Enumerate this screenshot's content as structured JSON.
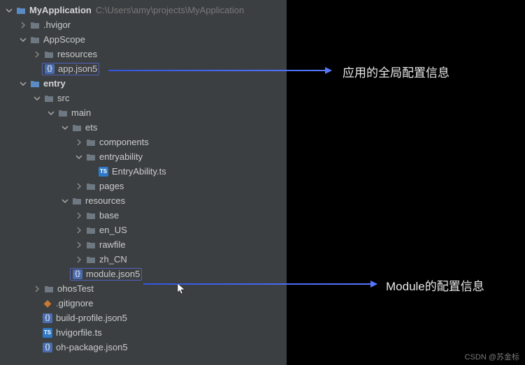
{
  "root": {
    "name": "MyApplication",
    "path": "C:\\Users\\amy\\projects\\MyApplication"
  },
  "tree": {
    "hvigor": ".hvigor",
    "appscope": "AppScope",
    "appscope_resources": "resources",
    "app_json5": "app.json5",
    "entry": "entry",
    "src": "src",
    "main": "main",
    "ets": "ets",
    "components": "components",
    "entryability": "entryability",
    "entryability_ts": "EntryAbility.ts",
    "pages": "pages",
    "resources": "resources",
    "base": "base",
    "en_us": "en_US",
    "rawfile": "rawfile",
    "zh_cn": "zh_CN",
    "module_json5": "module.json5",
    "ohostest": "ohosTest",
    "gitignore": ".gitignore",
    "build_profile": "build-profile.json5",
    "hvigorfile": "hvigorfile.ts",
    "oh_package": "oh-package.json5"
  },
  "annotations": {
    "app_json": "应用的全局配置信息",
    "module_json": "Module的配置信息"
  },
  "watermark": "CSDN @苏金标"
}
